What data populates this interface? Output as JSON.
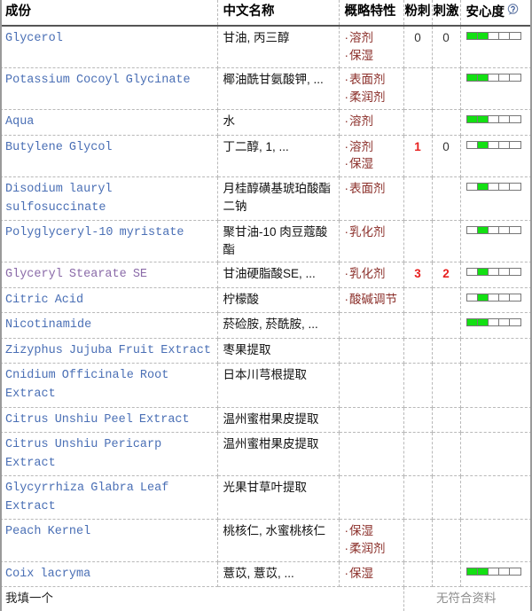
{
  "table": {
    "columns": [
      {
        "key": "inci",
        "label": "成份"
      },
      {
        "key": "cn",
        "label": "中文名称"
      },
      {
        "key": "prop",
        "label": "概略特性"
      },
      {
        "key": "acne",
        "label": "粉刺"
      },
      {
        "key": "irritation",
        "label": "刺激"
      },
      {
        "key": "safety",
        "label": "安心度"
      }
    ],
    "help_icon": "help-circle-icon",
    "bar_segments": 5,
    "rows": [
      {
        "inci": "Glycerol",
        "visited": false,
        "cn": "甘油, 丙三醇",
        "props": [
          "溶剂",
          "保湿"
        ],
        "acne": "0",
        "acne_warn": false,
        "irritation": "0",
        "irritation_warn": false,
        "safety_on": [
          1,
          2
        ]
      },
      {
        "inci": "Potassium Cocoyl Glycinate",
        "visited": false,
        "cn": "椰油酰甘氨酸钾, ...",
        "props": [
          "表面剂",
          "柔润剂"
        ],
        "acne": "",
        "acne_warn": false,
        "irritation": "",
        "irritation_warn": false,
        "safety_on": [
          1,
          2
        ]
      },
      {
        "inci": "Aqua",
        "visited": false,
        "cn": "水",
        "props": [
          "溶剂"
        ],
        "acne": "",
        "acne_warn": false,
        "irritation": "",
        "irritation_warn": false,
        "safety_on": [
          1,
          2
        ]
      },
      {
        "inci": "Butylene Glycol",
        "visited": false,
        "cn": "丁二醇, 1, ...",
        "props": [
          "溶剂",
          "保湿"
        ],
        "acne": "1",
        "acne_warn": true,
        "irritation": "0",
        "irritation_warn": false,
        "safety_on": [
          2
        ]
      },
      {
        "inci": "Disodium lauryl sulfosuccinate",
        "visited": false,
        "cn": "月桂醇磺基琥珀酸酯二钠",
        "props": [
          "表面剂"
        ],
        "acne": "",
        "acne_warn": false,
        "irritation": "",
        "irritation_warn": false,
        "safety_on": [
          2
        ]
      },
      {
        "inci": "Polyglyceryl-10 myristate",
        "visited": false,
        "cn": "聚甘油-10 肉豆蔻酸酯",
        "props": [
          "乳化剂"
        ],
        "acne": "",
        "acne_warn": false,
        "irritation": "",
        "irritation_warn": false,
        "safety_on": [
          2
        ]
      },
      {
        "inci": "Glyceryl Stearate SE",
        "visited": true,
        "cn": "甘油硬脂酸SE, ...",
        "props": [
          "乳化剂"
        ],
        "acne": "3",
        "acne_warn": true,
        "irritation": "2",
        "irritation_warn": true,
        "safety_on": [
          2
        ]
      },
      {
        "inci": "Citric Acid",
        "visited": false,
        "cn": "柠檬酸",
        "props": [
          "酸碱调节"
        ],
        "acne": "",
        "acne_warn": false,
        "irritation": "",
        "irritation_warn": false,
        "safety_on": [
          2
        ]
      },
      {
        "inci": "Nicotinamide",
        "visited": false,
        "cn": "菸硷胺, 菸酰胺, ...",
        "props": [],
        "acne": "",
        "acne_warn": false,
        "irritation": "",
        "irritation_warn": false,
        "safety_on": [
          1,
          2
        ]
      },
      {
        "inci": "Zizyphus Jujuba Fruit Extract",
        "visited": false,
        "cn": "枣果提取",
        "props": [],
        "acne": "",
        "acne_warn": false,
        "irritation": "",
        "irritation_warn": false,
        "safety_on": []
      },
      {
        "inci": "Cnidium Officinale Root Extract",
        "visited": false,
        "cn": "日本川芎根提取",
        "props": [],
        "acne": "",
        "acne_warn": false,
        "irritation": "",
        "irritation_warn": false,
        "safety_on": []
      },
      {
        "inci": "Citrus Unshiu Peel Extract",
        "visited": false,
        "cn": "温州蜜柑果皮提取",
        "props": [],
        "acne": "",
        "acne_warn": false,
        "irritation": "",
        "irritation_warn": false,
        "safety_on": []
      },
      {
        "inci": "Citrus Unshiu Pericarp Extract",
        "visited": false,
        "cn": "温州蜜柑果皮提取",
        "props": [],
        "acne": "",
        "acne_warn": false,
        "irritation": "",
        "irritation_warn": false,
        "safety_on": []
      },
      {
        "inci": "Glycyrrhiza Glabra Leaf Extract",
        "visited": false,
        "cn": "光果甘草叶提取",
        "props": [],
        "acne": "",
        "acne_warn": false,
        "irritation": "",
        "irritation_warn": false,
        "safety_on": []
      },
      {
        "inci": "Peach Kernel",
        "visited": false,
        "cn": "桃核仁, 水蜜桃核仁",
        "props": [
          "保湿",
          "柔润剂"
        ],
        "acne": "",
        "acne_warn": false,
        "irritation": "",
        "irritation_warn": false,
        "safety_on": []
      },
      {
        "inci": "Coix lacryma",
        "visited": false,
        "cn": "薏苡, 薏苡, ...",
        "props": [
          "保湿"
        ],
        "acne": "",
        "acne_warn": false,
        "irritation": "",
        "irritation_warn": false,
        "safety_on": [
          1,
          2
        ]
      }
    ],
    "footer": {
      "left_label": "我填一个",
      "right_label": "无符合资料"
    }
  }
}
